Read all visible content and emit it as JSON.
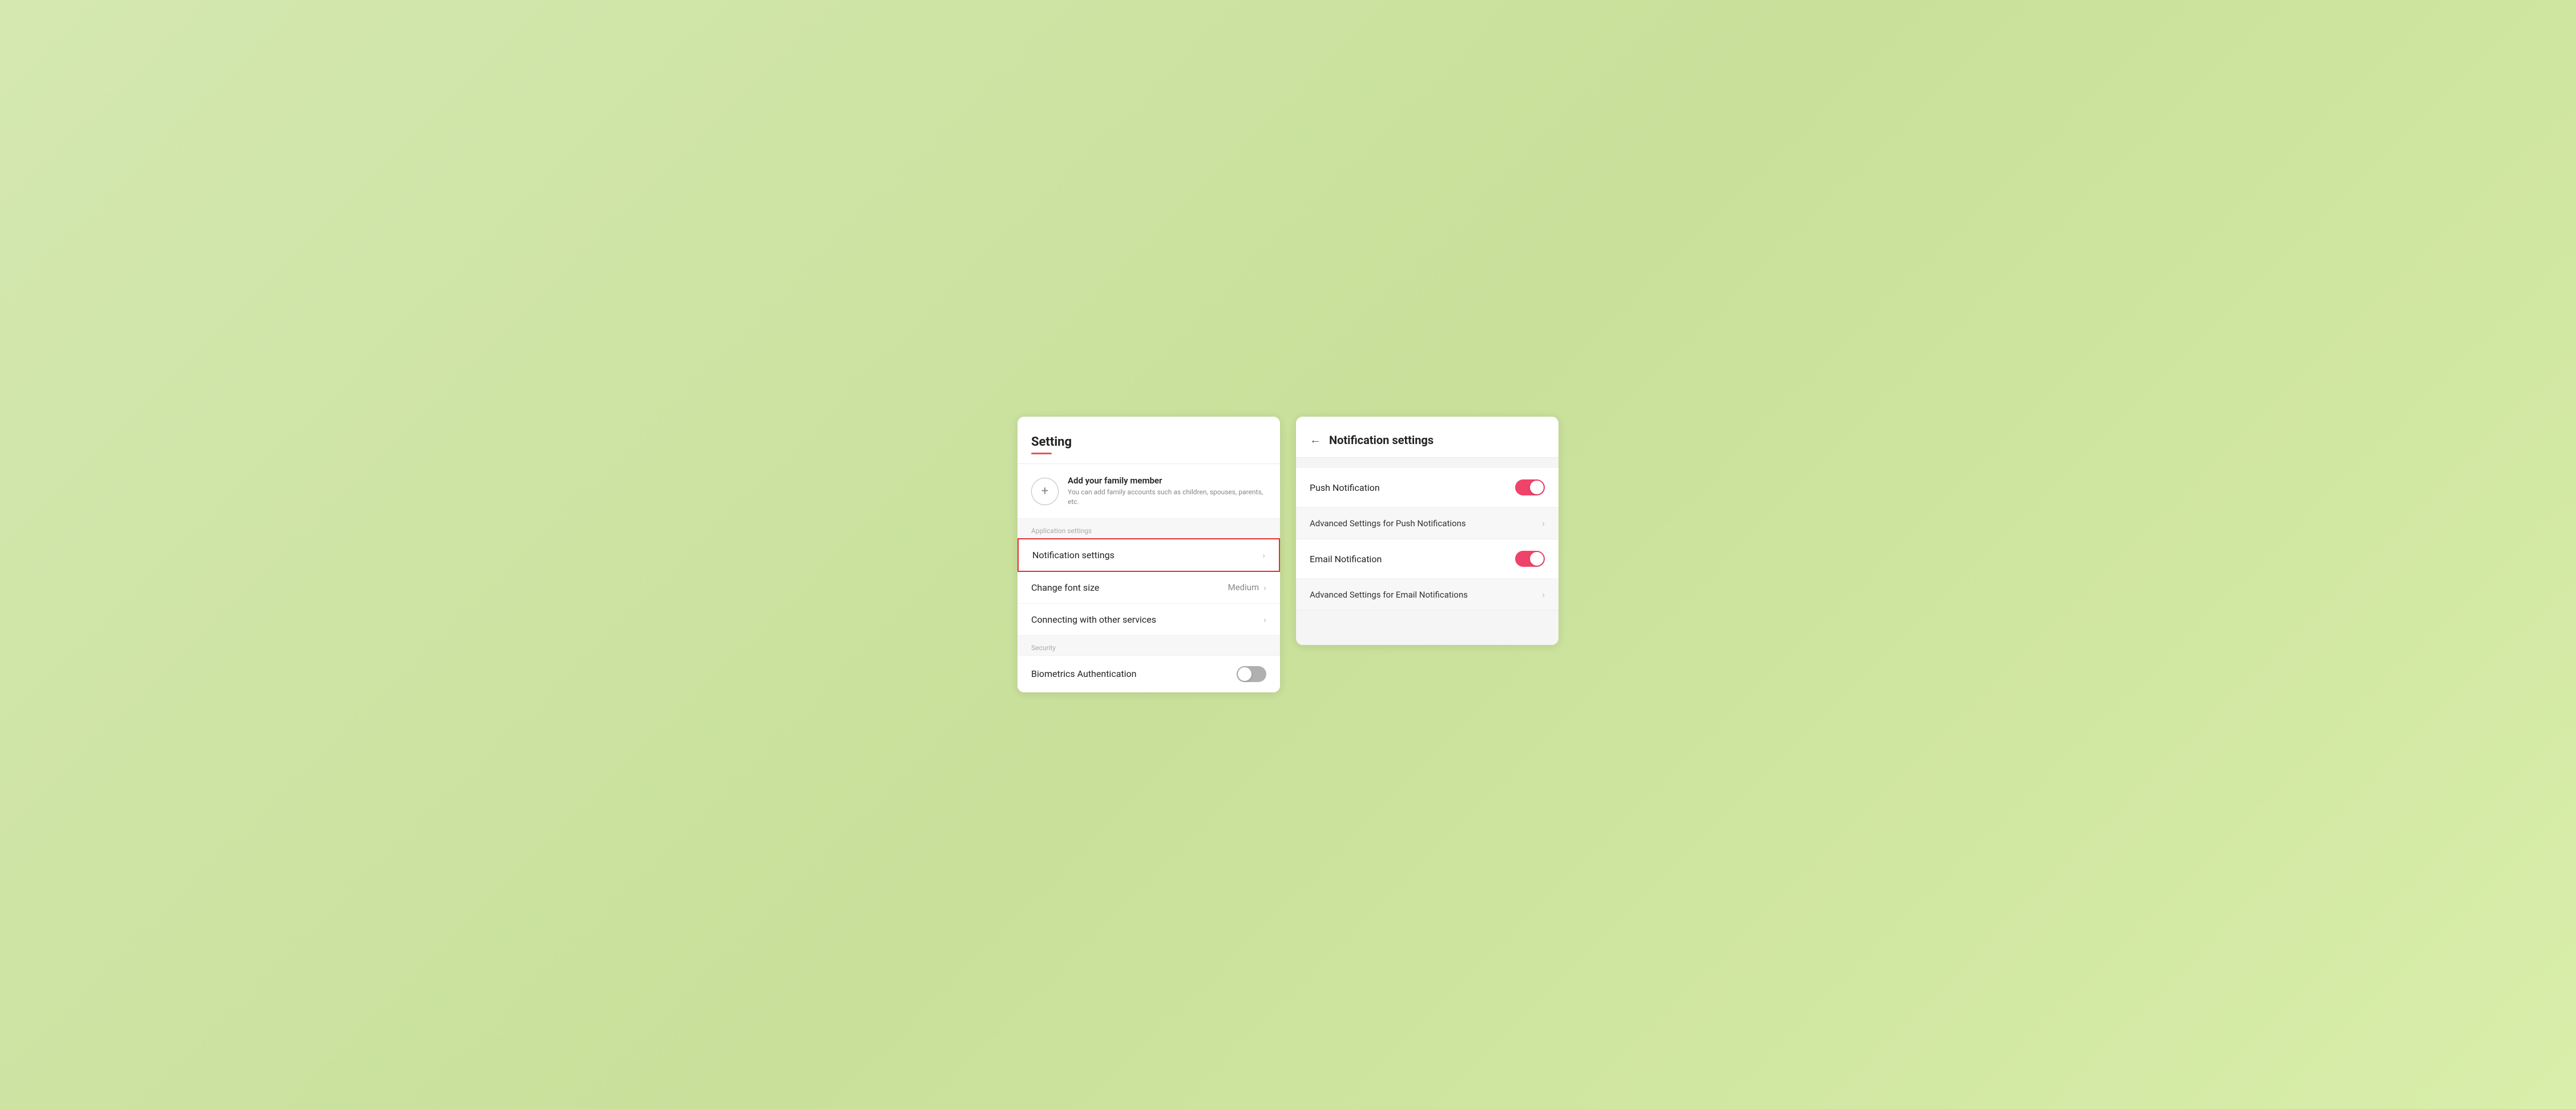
{
  "left_panel": {
    "title": "Setting",
    "family_section": {
      "title": "Add your family member",
      "subtitle": "You can add family accounts such as children, spouses, parents, etc.",
      "add_icon": "+"
    },
    "app_settings_label": "Application settings",
    "settings_items": [
      {
        "label": "Notification settings",
        "value": "",
        "highlighted": true
      },
      {
        "label": "Change font size",
        "value": "Medium",
        "highlighted": false
      },
      {
        "label": "Connecting with other services",
        "value": "",
        "highlighted": false
      }
    ],
    "security_label": "Security",
    "security_items": [
      {
        "label": "Biometrics Authentication",
        "toggle": "gray"
      }
    ]
  },
  "right_panel": {
    "back_label": "←",
    "title": "Notification settings",
    "notif_items": [
      {
        "label": "Push Notification",
        "type": "toggle",
        "toggle": "pink"
      },
      {
        "label": "Advanced Settings for Push Notifications",
        "type": "link"
      },
      {
        "label": "Email Notification",
        "type": "toggle",
        "toggle": "pink"
      },
      {
        "label": "Advanced Settings for Email Notifications",
        "type": "link"
      }
    ]
  },
  "icons": {
    "chevron": "›"
  }
}
